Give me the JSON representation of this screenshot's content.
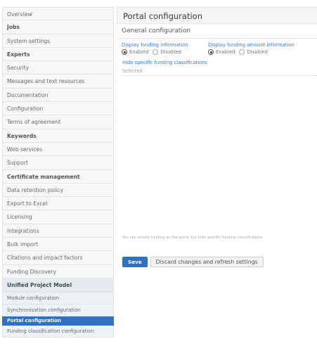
{
  "sidebar": {
    "items": [
      {
        "label": "Overview"
      },
      {
        "label": "Jobs"
      },
      {
        "label": "System settings"
      },
      {
        "label": "Experts"
      },
      {
        "label": "Security"
      },
      {
        "label": "Messages and text resources"
      },
      {
        "label": "Documentation"
      },
      {
        "label": "Configuration"
      },
      {
        "label": "Terms of agreement"
      },
      {
        "label": "Keywords"
      },
      {
        "label": "Web services"
      },
      {
        "label": "Support"
      },
      {
        "label": "Certificate management"
      },
      {
        "label": "Data retention policy"
      },
      {
        "label": "Export to Excel"
      },
      {
        "label": "Licensing"
      },
      {
        "label": "Integrations"
      },
      {
        "label": "Bulk import"
      },
      {
        "label": "Citations and impact factors"
      },
      {
        "label": "Funding Discovery"
      }
    ],
    "section": {
      "label": "Unified Project Model"
    },
    "sub_items": [
      {
        "label": "Module configuration"
      },
      {
        "label": "Synchronisation configuration"
      },
      {
        "label": "Portal configuration"
      },
      {
        "label": "Funding classification configuration"
      }
    ]
  },
  "main": {
    "title": "Portal configuration",
    "subsection": "General configuration",
    "funding_info": {
      "label": "Display funding information",
      "enabled": "Enabled",
      "disabled": "Disabled",
      "selected": "Enabled"
    },
    "funding_amount": {
      "label": "Display funding amount information",
      "enabled": "Enabled",
      "disabled": "Disabled",
      "selected": "Enabled"
    },
    "hide_label": "Hide specific funding classifications",
    "select_placeholder": "Selected",
    "help_text": "You can enable funding on the portal but hide specific funding classifications",
    "save_label": "Save",
    "discard_label": "Discard changes and refresh settings"
  },
  "colors": {
    "accent": "#2f72c4",
    "link": "#3a78c8"
  }
}
